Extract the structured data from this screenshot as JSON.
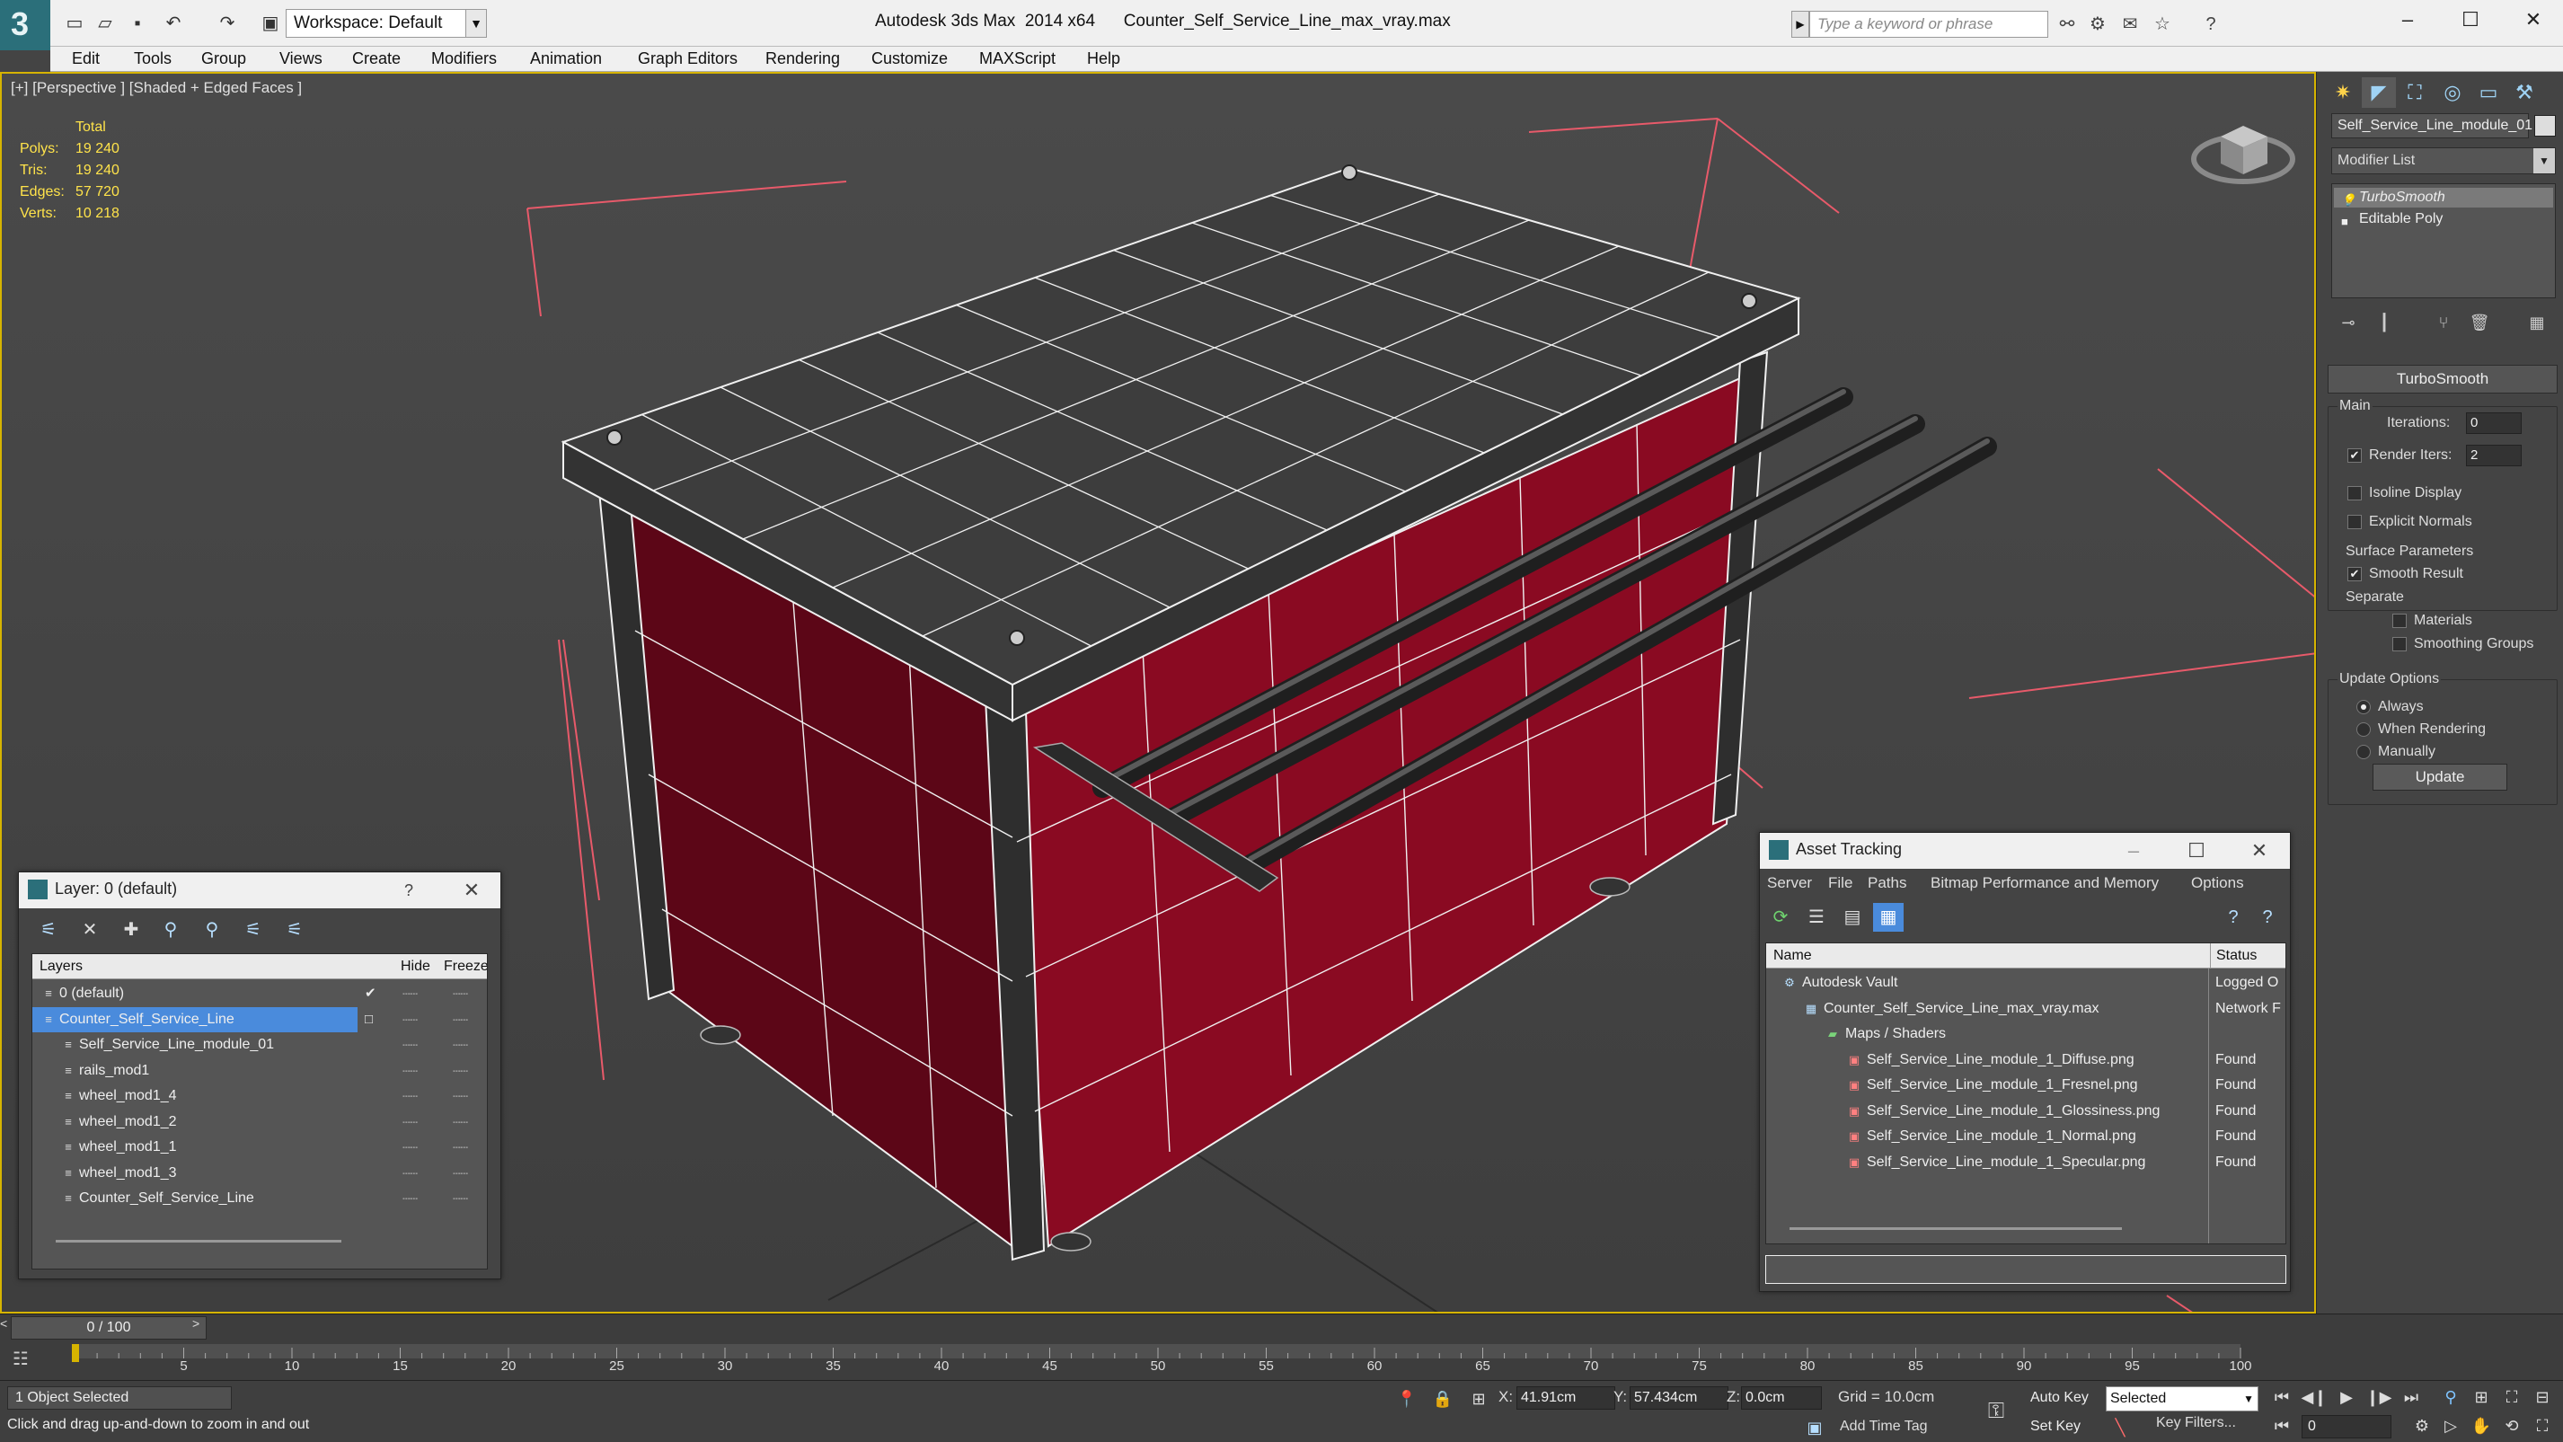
{
  "app": {
    "title": "Autodesk 3ds Max  2014 x64      Counter_Self_Service_Line_max_vray.max",
    "logo_letter": "3",
    "workspace_label": "Workspace: Default",
    "search_placeholder": "Type a keyword or phrase"
  },
  "menu": [
    "Edit",
    "Tools",
    "Group",
    "Views",
    "Create",
    "Modifiers",
    "Animation",
    "Graph Editors",
    "Rendering",
    "Customize",
    "MAXScript",
    "Help"
  ],
  "viewport": {
    "label": "[+] [Perspective ] [Shaded + Edged Faces ]",
    "stats": {
      "header": "Total",
      "rows": [
        {
          "label": "Polys:",
          "value": "19 240"
        },
        {
          "label": "Tris:",
          "value": "19 240"
        },
        {
          "label": "Edges:",
          "value": "57 720"
        },
        {
          "label": "Verts:",
          "value": "10 218"
        }
      ]
    },
    "colors": {
      "cabinet": "#8a0a22",
      "frame": "#2e2e2e",
      "wire": "#f0f0f0",
      "guides": "#e85a6a",
      "selection": "#d6b400"
    }
  },
  "command_panel": {
    "object_name": "Self_Service_Line_module_01",
    "modifier_list_label": "Modifier List",
    "stack": [
      "TurboSmooth",
      "Editable Poly"
    ],
    "turbosmooth": {
      "rollout_title": "TurboSmooth",
      "main_label": "Main",
      "iterations_label": "Iterations:",
      "iterations_value": "0",
      "render_iters_label": "Render Iters:",
      "render_iters_value": "2",
      "render_iters_checked": true,
      "isoline_label": "Isoline Display",
      "explicit_normals_label": "Explicit Normals",
      "surface_label": "Surface Parameters",
      "smooth_result_label": "Smooth Result",
      "separate_label": "Separate",
      "materials_label": "Materials",
      "smoothing_groups_label": "Smoothing Groups",
      "update_options_label": "Update Options",
      "always_label": "Always",
      "when_rendering_label": "When Rendering",
      "manually_label": "Manually",
      "update_button": "Update"
    }
  },
  "layer_dialog": {
    "title": "Layer: 0 (default)",
    "help": "?",
    "columns": {
      "layers": "Layers",
      "hide": "Hide",
      "freeze": "Freeze"
    },
    "rows": [
      {
        "name": "0 (default)",
        "level": 0,
        "selected": false,
        "check": "✔"
      },
      {
        "name": "Counter_Self_Service_Line",
        "level": 0,
        "selected": true,
        "check": "□"
      },
      {
        "name": "Self_Service_Line_module_01",
        "level": 1,
        "selected": false,
        "check": ""
      },
      {
        "name": "rails_mod1",
        "level": 1,
        "selected": false,
        "check": ""
      },
      {
        "name": "wheel_mod1_4",
        "level": 1,
        "selected": false,
        "check": ""
      },
      {
        "name": "wheel_mod1_2",
        "level": 1,
        "selected": false,
        "check": ""
      },
      {
        "name": "wheel_mod1_1",
        "level": 1,
        "selected": false,
        "check": ""
      },
      {
        "name": "wheel_mod1_3",
        "level": 1,
        "selected": false,
        "check": ""
      },
      {
        "name": "Counter_Self_Service_Line",
        "level": 1,
        "selected": false,
        "check": ""
      }
    ]
  },
  "asset_dialog": {
    "title": "Asset Tracking",
    "menu": [
      "Server",
      "File",
      "Paths",
      "Bitmap Performance and Memory",
      "Options"
    ],
    "columns": {
      "name": "Name",
      "status": "Status"
    },
    "rows": [
      {
        "name": "Autodesk Vault",
        "status": "Logged O",
        "level": 1
      },
      {
        "name": "Counter_Self_Service_Line_max_vray.max",
        "status": "Network F",
        "level": 2
      },
      {
        "name": "Maps / Shaders",
        "status": "",
        "level": 3
      },
      {
        "name": "Self_Service_Line_module_1_Diffuse.png",
        "status": "Found",
        "level": 4
      },
      {
        "name": "Self_Service_Line_module_1_Fresnel.png",
        "status": "Found",
        "level": 4
      },
      {
        "name": "Self_Service_Line_module_1_Glossiness.png",
        "status": "Found",
        "level": 4
      },
      {
        "name": "Self_Service_Line_module_1_Normal.png",
        "status": "Found",
        "level": 4
      },
      {
        "name": "Self_Service_Line_module_1_Specular.png",
        "status": "Found",
        "level": 4
      }
    ]
  },
  "timeline": {
    "slider_label": "0 / 100",
    "ticks": [
      "5",
      "10",
      "15",
      "20",
      "25",
      "30",
      "35",
      "40",
      "45",
      "50",
      "55",
      "60",
      "65",
      "70",
      "75",
      "80",
      "85",
      "90",
      "95",
      "100"
    ]
  },
  "status": {
    "selection": "1 Object Selected",
    "prompt": "Click and drag up-and-down to zoom in and out",
    "x_label": "X:",
    "x": "41.91cm",
    "y_label": "Y:",
    "y": "57.434cm",
    "z_label": "Z:",
    "z": "0.0cm",
    "grid": "Grid = 10.0cm",
    "add_time_tag": "Add Time Tag",
    "auto_key": "Auto Key",
    "set_key": "Set Key",
    "selected_option": "Selected",
    "key_filters": "Key Filters...",
    "frame": "0"
  }
}
